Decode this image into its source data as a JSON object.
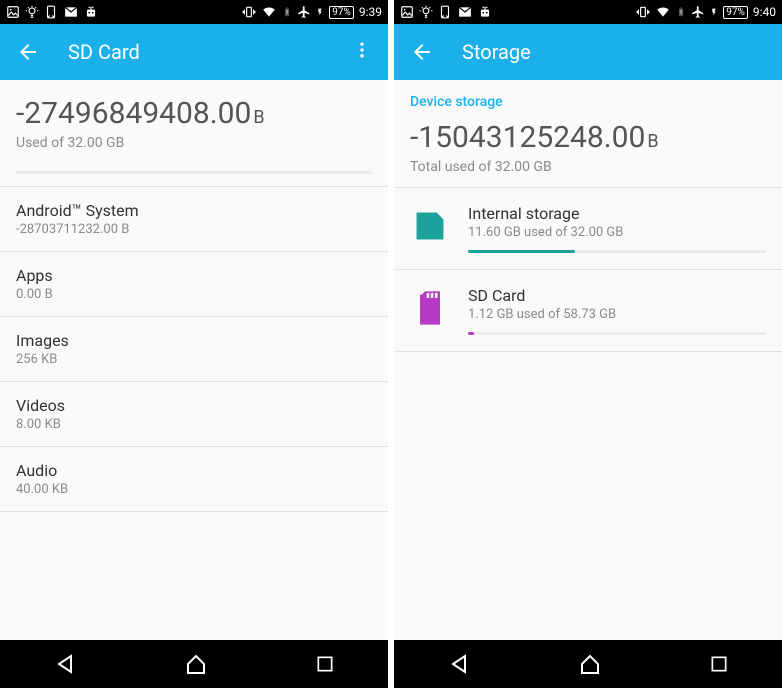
{
  "left": {
    "status": {
      "battery": "97%",
      "time": "9:39"
    },
    "title": "SD Card",
    "summary_value": "-27496849408.00",
    "summary_unit": "B",
    "summary_sub": "Used of 32.00 GB",
    "rows": [
      {
        "label": "Android™ System",
        "value": "-28703711232.00 B"
      },
      {
        "label": "Apps",
        "value": "0.00 B"
      },
      {
        "label": "Images",
        "value": "256 KB"
      },
      {
        "label": "Videos",
        "value": "8.00 KB"
      },
      {
        "label": "Audio",
        "value": "40.00 KB"
      }
    ]
  },
  "right": {
    "status": {
      "battery": "97%",
      "time": "9:40"
    },
    "title": "Storage",
    "section": "Device storage",
    "summary_value": "-15043125248.00",
    "summary_unit": "B",
    "summary_sub": "Total used of 32.00 GB",
    "volumes": [
      {
        "label": "Internal storage",
        "value": "11.60 GB used of 32.00 GB",
        "color": "#1da29b",
        "pct": 36
      },
      {
        "label": "SD Card",
        "value": "1.12 GB used of 58.73 GB",
        "color": "#b53cc2",
        "pct": 2
      }
    ]
  }
}
